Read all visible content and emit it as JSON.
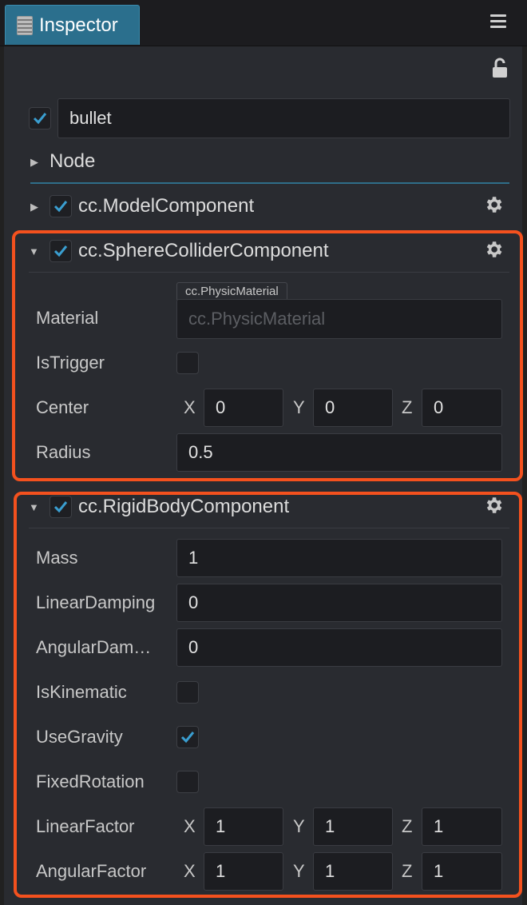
{
  "window": {
    "tab_title": "Inspector"
  },
  "node": {
    "name": "bullet",
    "enabled": true,
    "section_label": "Node"
  },
  "components": {
    "model": {
      "title": "cc.ModelComponent",
      "enabled": true
    },
    "sphere_collider": {
      "title": "cc.SphereColliderComponent",
      "enabled": true,
      "material_label": "Material",
      "material_tag": "cc.PhysicMaterial",
      "material_placeholder": "cc.PhysicMaterial",
      "istrigger_label": "IsTrigger",
      "istrigger": false,
      "center_label": "Center",
      "center": {
        "x": "0",
        "y": "0",
        "z": "0"
      },
      "radius_label": "Radius",
      "radius": "0.5"
    },
    "rigid_body": {
      "title": "cc.RigidBodyComponent",
      "enabled": true,
      "mass_label": "Mass",
      "mass": "1",
      "linear_damping_label": "LinearDamping",
      "linear_damping": "0",
      "angular_damping_label": "AngularDam…",
      "angular_damping": "0",
      "is_kinematic_label": "IsKinematic",
      "is_kinematic": false,
      "use_gravity_label": "UseGravity",
      "use_gravity": true,
      "fixed_rotation_label": "FixedRotation",
      "fixed_rotation": false,
      "linear_factor_label": "LinearFactor",
      "linear_factor": {
        "x": "1",
        "y": "1",
        "z": "1"
      },
      "angular_factor_label": "AngularFactor",
      "angular_factor": {
        "x": "1",
        "y": "1",
        "z": "1"
      }
    }
  },
  "axis_labels": {
    "x": "X",
    "y": "Y",
    "z": "Z"
  },
  "icons": {
    "menu": "hamburger-menu-icon",
    "lock": "unlock-icon",
    "gear": "gear-icon",
    "collapsed": "triangle-right-icon",
    "expanded": "triangle-down-icon"
  },
  "colors": {
    "accent": "#2b6f8d",
    "check": "#3a9ed0",
    "highlight": "#f4511e",
    "panel_bg": "#292b30"
  }
}
